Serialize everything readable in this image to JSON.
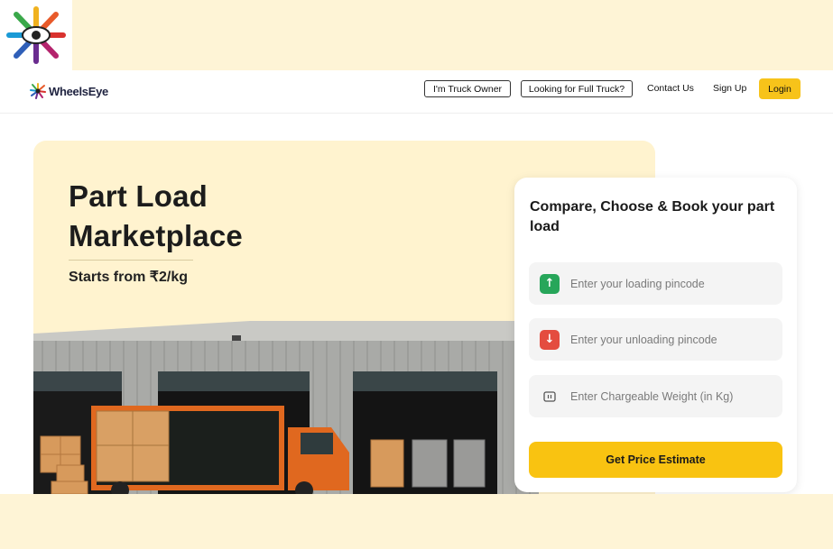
{
  "brand": {
    "name": "WheelsEye",
    "accent": "#f7c31a"
  },
  "nav": {
    "truck_owner": "I'm Truck Owner",
    "full_truck": "Looking for Full Truck?",
    "contact": "Contact Us",
    "signup": "Sign Up",
    "login": "Login"
  },
  "hero": {
    "title_line1": "Part Load",
    "title_line2": "Marketplace",
    "subtitle": "Starts from ₹2/kg"
  },
  "form": {
    "title": "Compare, Choose & Book your part load",
    "loading_placeholder": "Enter your loading pincode",
    "unloading_placeholder": "Enter your unloading pincode",
    "weight_placeholder": "Enter Chargeable Weight (in Kg)",
    "cta": "Get Price Estimate"
  },
  "icons": {
    "loading": "arrow-up-icon",
    "unloading": "arrow-down-icon",
    "weight": "weight-icon"
  }
}
